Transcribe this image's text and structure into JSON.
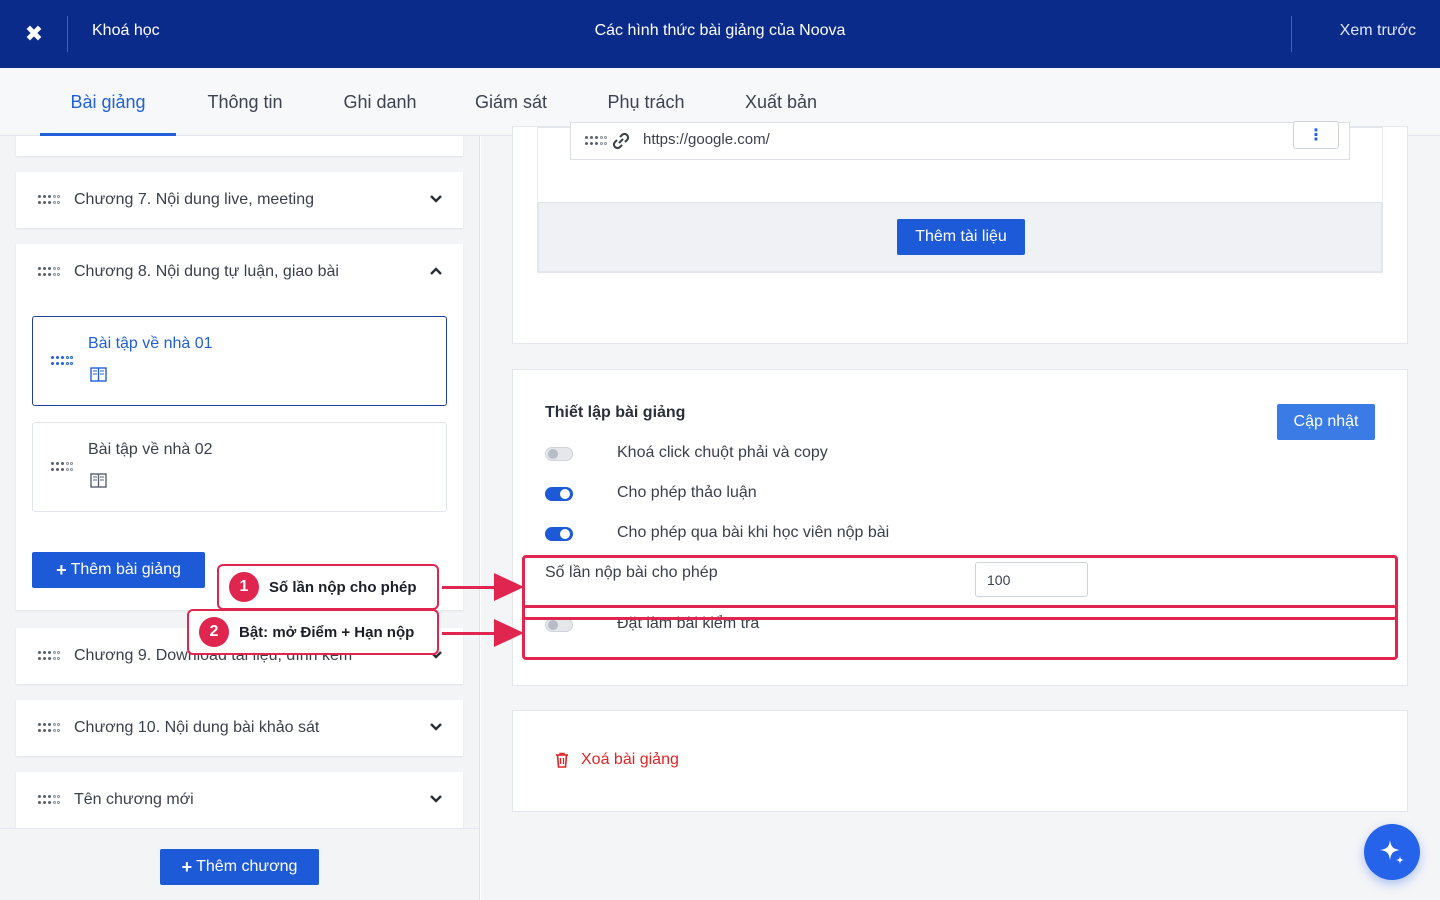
{
  "topbar": {
    "close_label": "✖",
    "course_link": "Khoá học",
    "title": "Các hình thức bài giảng của Noova",
    "preview": "Xem trước"
  },
  "tabs": [
    "Bài giảng",
    "Thông tin",
    "Ghi danh",
    "Giám sát",
    "Phụ trách",
    "Xuất bản"
  ],
  "active_tab": "Bài giảng",
  "chapters": [
    {
      "title": "Chương 7. Nội dung live, meeting",
      "expanded": false
    },
    {
      "title": "Chương 8. Nội dung tự luận, giao bài",
      "expanded": true
    },
    {
      "title": "Chương 9. Download tài liệu, đính kèm",
      "expanded": false
    },
    {
      "title": "Chương 10. Nội dung bài khảo sát",
      "expanded": false
    },
    {
      "title": "Tên chương mới",
      "expanded": false
    }
  ],
  "lessons": [
    {
      "title": "Bài tập về nhà 01",
      "selected": true
    },
    {
      "title": "Bài tập về nhà 02",
      "selected": false
    }
  ],
  "add_lesson_label": "Thêm bài giảng",
  "add_chapter_label": "Thêm chương",
  "attachments": {
    "url": "https://google.com/",
    "add_doc_label": "Thêm tài liệu"
  },
  "settings": {
    "title": "Thiết lập bài giảng",
    "update_label": "Cập nhật",
    "toggles": [
      {
        "label": "Khoá click chuột phải và copy",
        "on": false
      },
      {
        "label": "Cho phép thảo luận",
        "on": true
      },
      {
        "label": "Cho phép qua bài khi học viên nộp bài",
        "on": true
      }
    ],
    "attempts_label": "Số lần nộp bài cho phép",
    "attempts_value": "100",
    "exam_label": "Đặt làm bài kiểm tra",
    "exam_on": false
  },
  "delete_label": "Xoá bài giảng",
  "annotations": [
    {
      "num": "1",
      "text": "Số lần nộp cho phép"
    },
    {
      "num": "2",
      "text": "Bật: mở Điểm + Hạn nộp"
    }
  ],
  "colors": {
    "primary": "#1d5ad8",
    "header": "#0b2b8a",
    "annotation": "#e0264e",
    "danger": "#e02424"
  }
}
